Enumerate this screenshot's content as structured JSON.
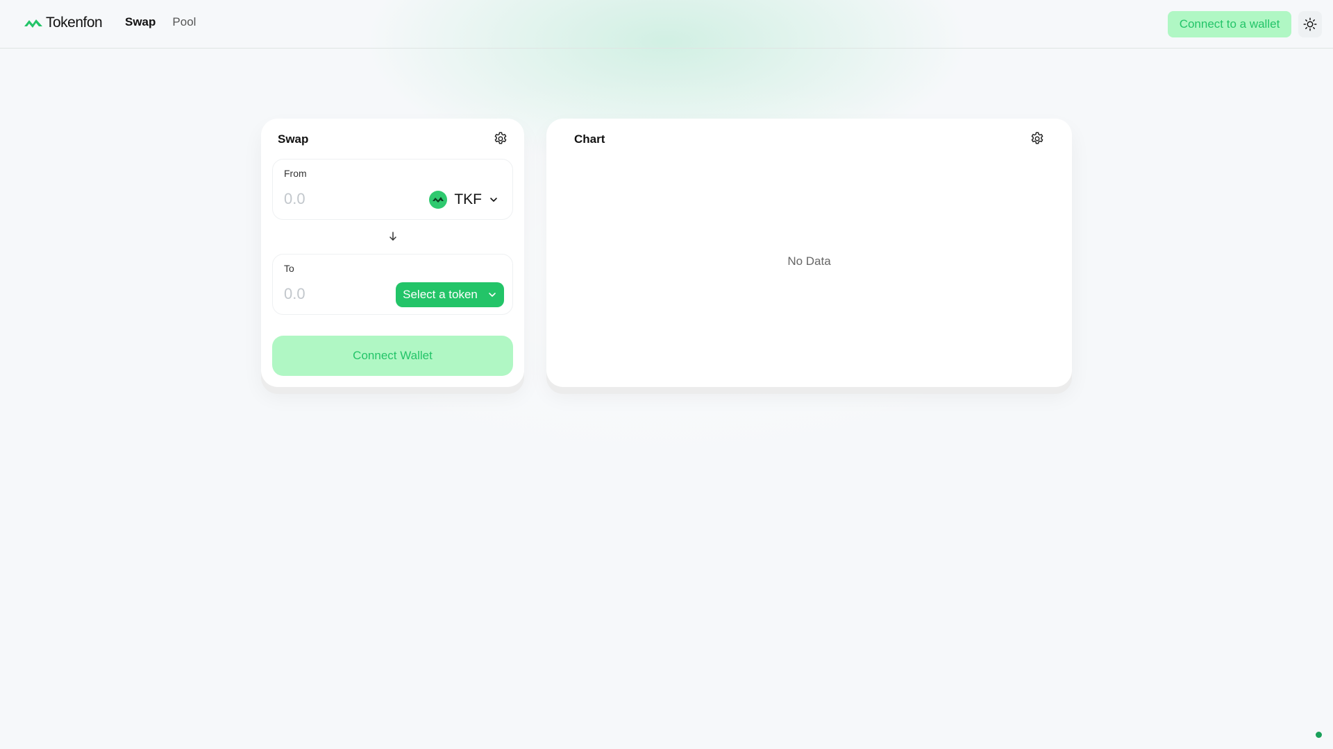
{
  "brand": {
    "name": "Tokenfon",
    "accent": "#23c468",
    "accent_light": "#b0f7c4"
  },
  "nav": {
    "items": [
      {
        "label": "Swap",
        "active": true
      },
      {
        "label": "Pool",
        "active": false
      }
    ]
  },
  "header": {
    "connect_label": "Connect to a wallet",
    "theme_icon": "sun-icon"
  },
  "swap": {
    "title": "Swap",
    "settings_icon": "gear-icon",
    "from": {
      "label": "From",
      "placeholder": "0.0",
      "token_symbol": "TKF"
    },
    "to": {
      "label": "To",
      "placeholder": "0.0",
      "select_label": "Select a token"
    },
    "connect_label": "Connect Wallet"
  },
  "chart": {
    "title": "Chart",
    "settings_icon": "gear-icon",
    "empty_text": "No Data"
  }
}
